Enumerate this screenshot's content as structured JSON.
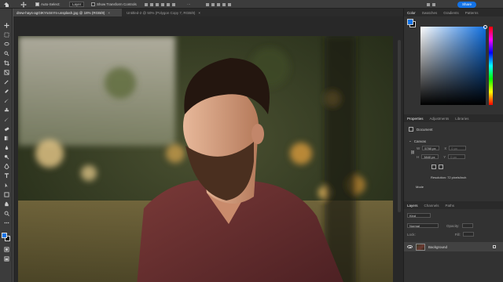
{
  "options_bar": {
    "auto_select_label": "Auto-Select:",
    "auto_select_target": "Layer",
    "show_transform_label": "Show Transform Controls",
    "more_label": "···",
    "share_label": "Share"
  },
  "tabs": [
    {
      "label": "drew-hays-agGIKYs4mYs-unsplash.jpg @ 18% (RGB/8)",
      "close": "×",
      "active": true
    },
    {
      "label": "Untitled-2 @ 50% (Polygon Copy 7, RGB/8)",
      "close": "×",
      "active": false
    }
  ],
  "panels": {
    "color": {
      "tabs": [
        "Color",
        "Swatches",
        "Gradients",
        "Patterns"
      ],
      "foreground": "#1473e6",
      "background": "#000000"
    },
    "properties": {
      "tabs": [
        "Properties",
        "Adjustments",
        "Libraries"
      ],
      "document_label": "Document",
      "canvas_heading": "Canvas",
      "w_label": "W",
      "w_value": "5760 px",
      "h_label": "H",
      "h_value": "3840 px",
      "x_label": "X",
      "x_value": "0 px",
      "y_label": "Y",
      "y_value": "0 px",
      "resolution": "Resolution: 72 pixels/inch",
      "mode_label": "Mode"
    },
    "layers": {
      "tabs": [
        "Layers",
        "Channels",
        "Paths"
      ],
      "kind_label": "Kind",
      "blend_mode": "Normal",
      "opacity_label": "Opacity:",
      "lock_label": "Lock:",
      "fill_label": "Fill:",
      "layer_name": "Background"
    }
  },
  "colors": {
    "accent": "#1473e6",
    "panel_bg": "#323232",
    "chrome_bg": "#3c3c3c",
    "canvas_bg": "#282828"
  }
}
